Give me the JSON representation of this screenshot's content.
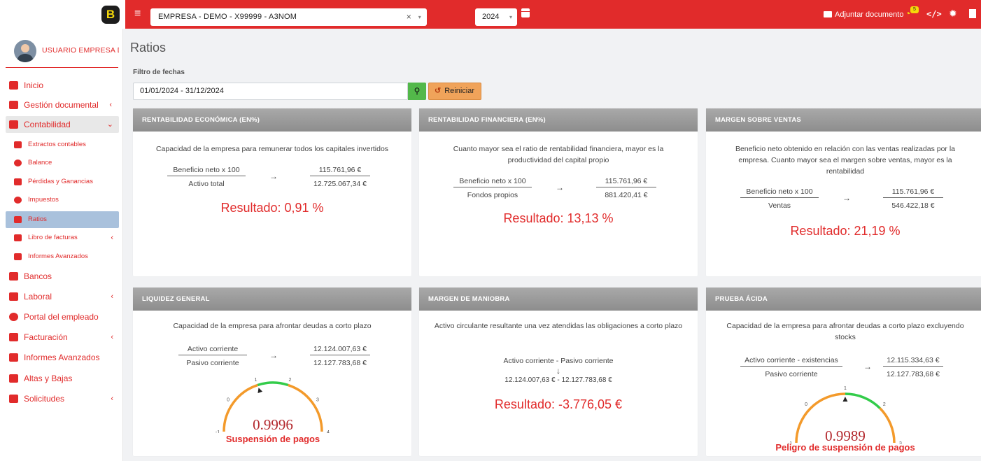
{
  "topbar": {
    "logo": "B",
    "company": "EMPRESA - DEMO - X99999 - A3NOM",
    "year": "2024",
    "attach_label": "Adjuntar documento",
    "notification_count": "5",
    "code_icon": "</>"
  },
  "sidebar": {
    "user_name": "USUARIO EMPRESA DEMO",
    "items": [
      {
        "label": "Inicio",
        "icon": "home-icon"
      },
      {
        "label": "Gestión documental",
        "icon": "folder-icon",
        "chevron": "‹"
      },
      {
        "label": "Contabilidad",
        "icon": "document-icon",
        "chevron": "⌄"
      },
      {
        "label": "Extractos contables",
        "icon": "cc-icon"
      },
      {
        "label": "Balance",
        "icon": "pie-chart-icon"
      },
      {
        "label": "Pérdidas y Ganancias",
        "icon": "line-chart-icon"
      },
      {
        "label": "Impuestos",
        "icon": "search-icon"
      },
      {
        "label": "Ratios",
        "icon": "percent-icon"
      },
      {
        "label": "Libro de facturas",
        "icon": "book-icon",
        "chevron": "‹"
      },
      {
        "label": "Informes Avanzados",
        "icon": "pdf-icon"
      },
      {
        "label": "Bancos",
        "icon": "money-icon"
      },
      {
        "label": "Laboral",
        "icon": "user-icon",
        "chevron": "‹"
      },
      {
        "label": "Portal del empleado",
        "icon": "clock-icon"
      },
      {
        "label": "Facturación",
        "icon": "receipt-icon",
        "chevron": "‹"
      },
      {
        "label": "Informes Avanzados",
        "icon": "report-icon"
      },
      {
        "label": "Altas y Bajas",
        "icon": "briefcase-icon"
      },
      {
        "label": "Solicitudes",
        "icon": "envelope-icon",
        "chevron": "‹"
      }
    ]
  },
  "main": {
    "title": "Ratios",
    "filter_label": "Filtro de fechas",
    "date_range": "01/01/2024 - 31/12/2024",
    "reset_label": "Reiniciar",
    "cards": [
      {
        "title": "RENTABILIDAD ECONÓMICA (EN%)",
        "description": "Capacidad de la empresa para remunerar todos los capitales invertidos",
        "formula_num": "Beneficio neto x 100",
        "formula_den": "Activo total",
        "value_num": "115.761,96 €",
        "value_den": "12.725.067,34 €",
        "result": "Resultado: 0,91 %"
      },
      {
        "title": "RENTABILIDAD FINANCIERA (EN%)",
        "description": "Cuanto mayor sea el ratio de rentabilidad financiera, mayor es la productividad del capital propio",
        "formula_num": "Beneficio neto x 100",
        "formula_den": "Fondos propios",
        "value_num": "115.761,96 €",
        "value_den": "881.420,41 €",
        "result": "Resultado: 13,13 %"
      },
      {
        "title": "MARGEN SOBRE VENTAS",
        "description": "Beneficio neto obtenido en relación con las ventas realizadas por la empresa. Cuanto mayor sea el margen sobre ventas, mayor es la rentabilidad",
        "formula_num": "Beneficio neto x 100",
        "formula_den": "Ventas",
        "value_num": "115.761,96 €",
        "value_den": "546.422,18 €",
        "result": "Resultado: 21,19 %"
      },
      {
        "title": "LIQUIDEZ GENERAL",
        "description": "Capacidad de la empresa para afrontar deudas a corto plazo",
        "formula_num": "Activo corriente",
        "formula_den": "Pasivo corriente",
        "value_num": "12.124.007,63 €",
        "value_den": "12.127.783,68 €",
        "gauge_value": 0.9996,
        "gauge_value_label": "0.9996",
        "gauge_status": "Suspensión de pagos",
        "gauge_min": -1,
        "gauge_max": 4,
        "gauge_ticks": [
          "-1",
          "0",
          "1",
          "2",
          "3",
          "4"
        ]
      },
      {
        "title": "MARGEN DE MANIOBRA",
        "description": "Activo circulante resultante una vez atendidas las obligaciones a corto plazo",
        "formula_text": "Activo corriente - Pasivo corriente",
        "arrow": "↓",
        "values_text": "12.124.007,63 € - 12.127.783,68 €",
        "result": "Resultado: -3.776,05 €"
      },
      {
        "title": "PRUEBA ÁCIDA",
        "description": "Capacidad de la empresa para afrontar deudas a corto plazo excluyendo stocks",
        "formula_num": "Activo corriente - existencias",
        "formula_den": "Pasivo corriente",
        "value_num": "12.115.334,63 €",
        "value_den": "12.127.783,68 €",
        "gauge_value": 0.9989,
        "gauge_value_label": "0.9989",
        "gauge_status": "Peligro de suspensión de pagos",
        "gauge_min": -1,
        "gauge_max": 3,
        "gauge_ticks": [
          "-1",
          "0",
          "1",
          "2",
          "3"
        ]
      }
    ]
  },
  "colors": {
    "brand_red": "#e12b2b",
    "gauge_orange": "#f39a2b",
    "gauge_green": "#33cc4a",
    "active_item": "#a9c1dc"
  }
}
